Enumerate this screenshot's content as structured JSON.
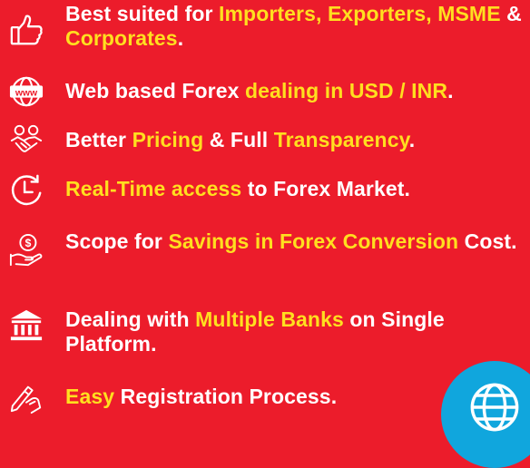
{
  "features": [
    {
      "icon": "thumbs-up-icon",
      "segments": [
        {
          "text": "Best suited for ",
          "hl": false
        },
        {
          "text": "Importers, Exporters, MSME",
          "hl": true
        },
        {
          "text": " & ",
          "hl": false
        },
        {
          "text": "Corporates",
          "hl": true
        },
        {
          "text": ".",
          "hl": false
        }
      ]
    },
    {
      "icon": "www-globe-icon",
      "segments": [
        {
          "text": "Web based Forex ",
          "hl": false
        },
        {
          "text": "dealing in USD / INR",
          "hl": true
        },
        {
          "text": ".",
          "hl": false
        }
      ]
    },
    {
      "icon": "handshake-icon",
      "segments": [
        {
          "text": "Better ",
          "hl": false
        },
        {
          "text": "Pricing",
          "hl": true
        },
        {
          "text": " & Full ",
          "hl": false
        },
        {
          "text": "Transparency",
          "hl": true
        },
        {
          "text": ".",
          "hl": false
        }
      ]
    },
    {
      "icon": "clock-icon",
      "segments": [
        {
          "text": "Real-Time access",
          "hl": true
        },
        {
          "text": " to Forex Market.",
          "hl": false
        }
      ]
    },
    {
      "icon": "coin-hand-icon",
      "segments": [
        {
          "text": "Scope for ",
          "hl": false
        },
        {
          "text": "Savings in Forex Conversion",
          "hl": true
        },
        {
          "text": " Cost.",
          "hl": false
        }
      ]
    },
    {
      "icon": "bank-icon",
      "segments": [
        {
          "text": "Dealing with ",
          "hl": false
        },
        {
          "text": "Multiple Banks",
          "hl": true
        },
        {
          "text": " on Single Platform.",
          "hl": false
        }
      ]
    },
    {
      "icon": "signing-hand-icon",
      "segments": [
        {
          "text": "Easy",
          "hl": true
        },
        {
          "text": " Registration Process.",
          "hl": false
        }
      ]
    }
  ],
  "badge_icon": "globe-icon",
  "colors": {
    "background": "#ec1c2b",
    "text": "#ffffff",
    "highlight": "#ffdf1f",
    "badge": "#10a6dd"
  }
}
